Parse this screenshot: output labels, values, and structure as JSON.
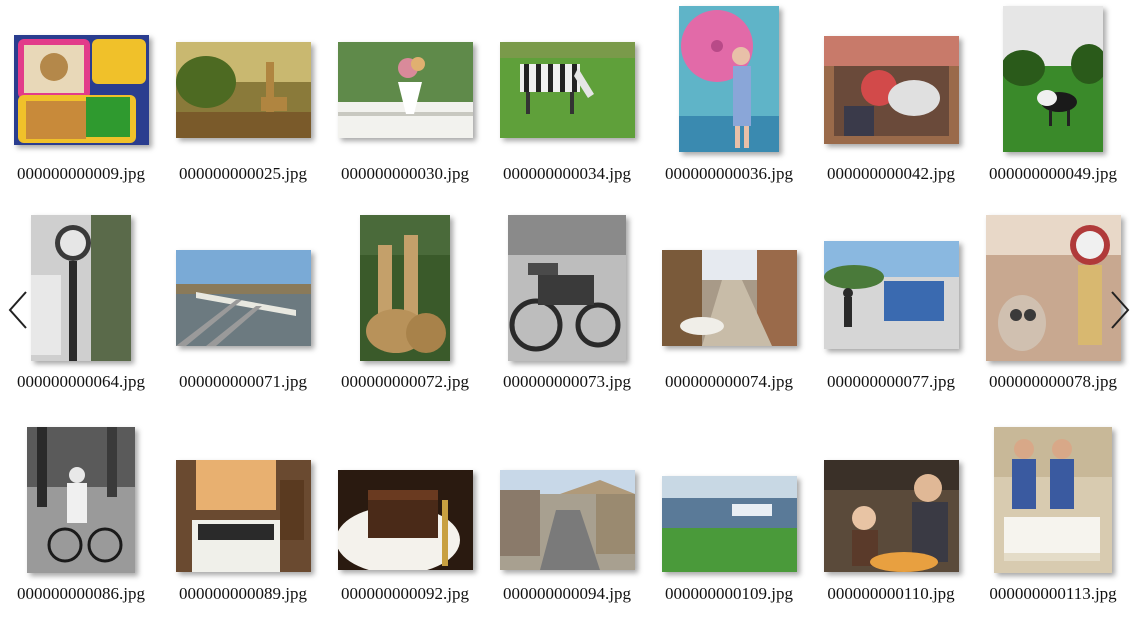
{
  "gallery": {
    "rows": [
      [
        {
          "name": "000000000009.jpg",
          "icon": "bento-lunchbox-photo"
        },
        {
          "name": "000000000025.jpg",
          "icon": "giraffe-photo"
        },
        {
          "name": "000000000030.jpg",
          "icon": "flower-vase-photo"
        },
        {
          "name": "000000000034.jpg",
          "icon": "zebra-photo"
        },
        {
          "name": "000000000036.jpg",
          "icon": "woman-umbrella-photo"
        },
        {
          "name": "000000000042.jpg",
          "icon": "dog-basket-photo"
        },
        {
          "name": "000000000049.jpg",
          "icon": "horse-field-photo"
        }
      ],
      [
        {
          "name": "000000000064.jpg",
          "icon": "street-clock-photo"
        },
        {
          "name": "000000000071.jpg",
          "icon": "train-tracks-photo"
        },
        {
          "name": "000000000072.jpg",
          "icon": "giraffes-photo"
        },
        {
          "name": "000000000073.jpg",
          "icon": "motorcycle-photo"
        },
        {
          "name": "000000000074.jpg",
          "icon": "dog-street-photo"
        },
        {
          "name": "000000000077.jpg",
          "icon": "skatepark-photo"
        },
        {
          "name": "000000000078.jpg",
          "icon": "clock-figurine-photo"
        }
      ],
      [
        {
          "name": "000000000086.jpg",
          "icon": "man-bicycle-photo"
        },
        {
          "name": "000000000089.jpg",
          "icon": "kitchen-stove-photo"
        },
        {
          "name": "000000000092.jpg",
          "icon": "chocolate-cake-photo"
        },
        {
          "name": "000000000094.jpg",
          "icon": "city-street-photo"
        },
        {
          "name": "000000000109.jpg",
          "icon": "river-park-photo"
        },
        {
          "name": "000000000110.jpg",
          "icon": "family-meal-photo"
        },
        {
          "name": "000000000113.jpg",
          "icon": "people-cake-photo"
        }
      ]
    ],
    "nav": {
      "prev_icon": "chevron-left-icon",
      "next_icon": "chevron-right-icon"
    }
  }
}
